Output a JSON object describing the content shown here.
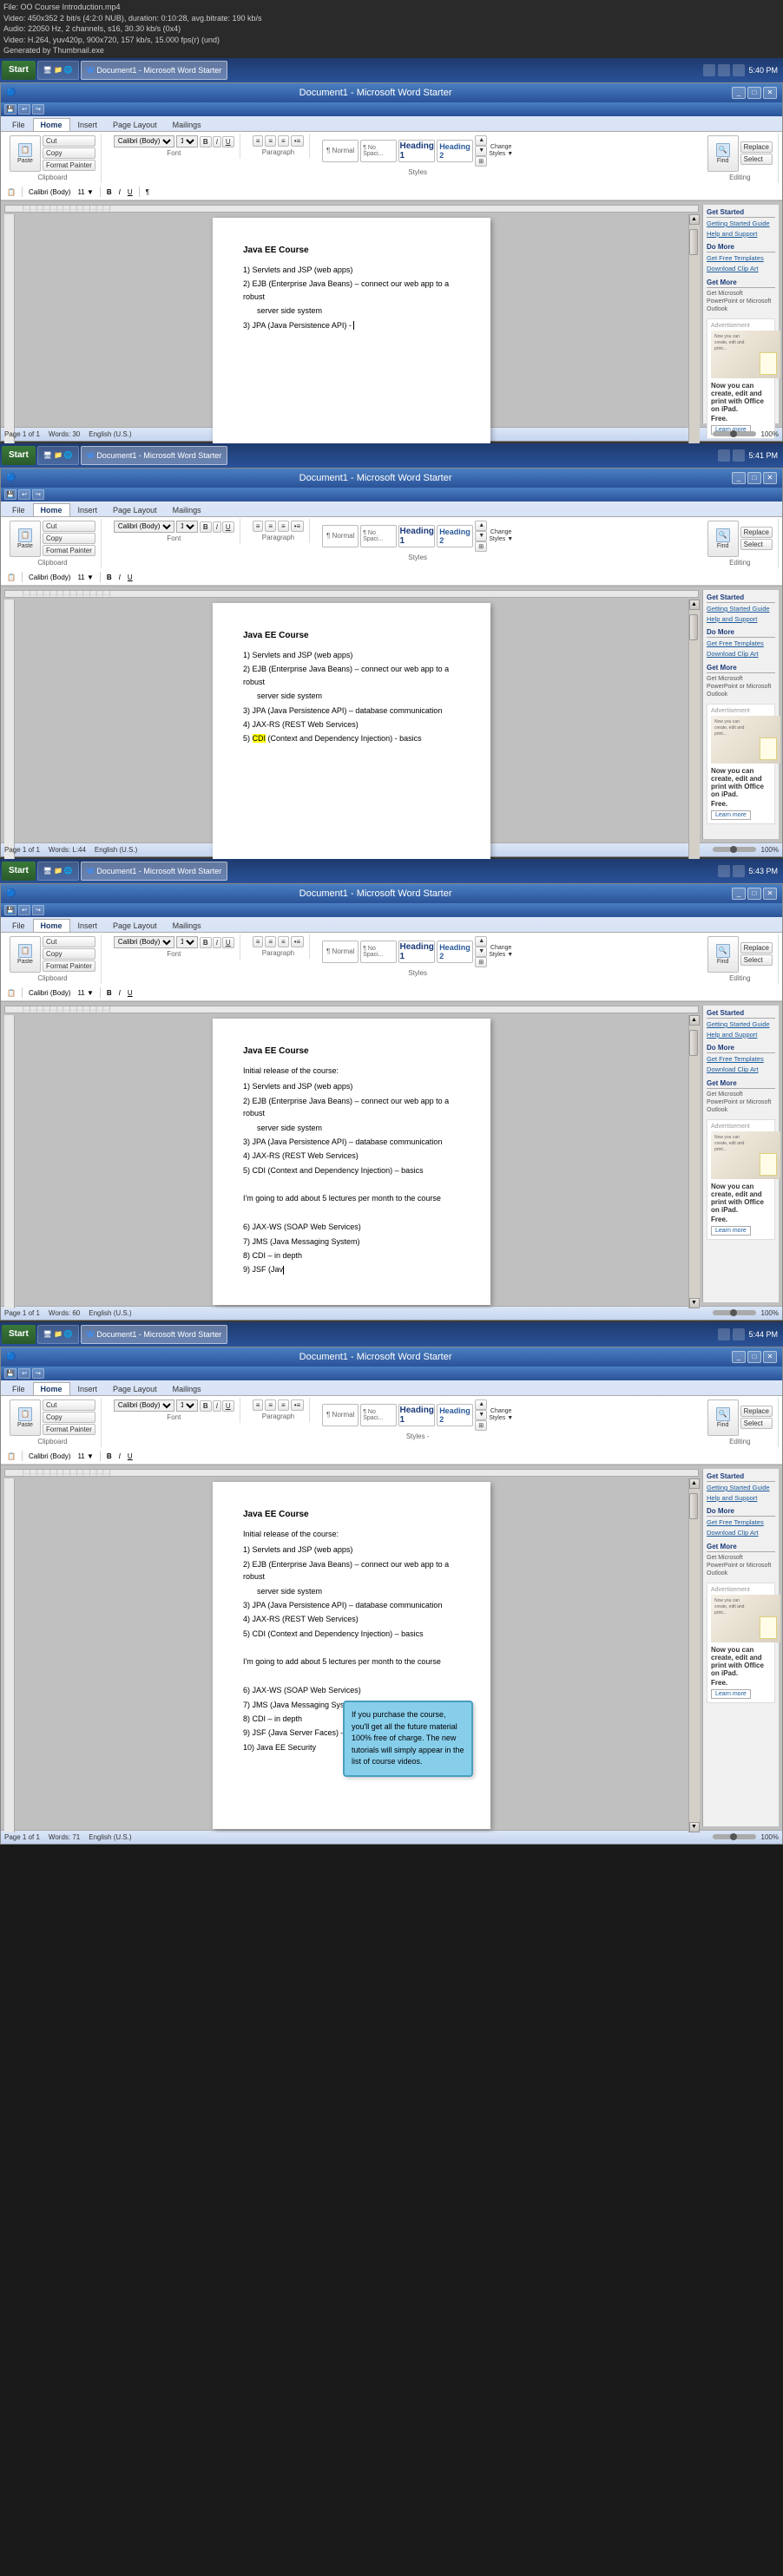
{
  "video_info": {
    "file": "File: OO Course Introduction.mp4",
    "specs1": "Video: 450x352 2 bit/s (4:2:0 NUB), duration: 0:10:28, avg.bitrate: 190 kb/s",
    "specs2": "Audio: 22050 Hz, 2 channels, s16, 30.30 kb/s (0x4)",
    "specs3": "Video: H.264, yuv420p, 900x720, 157 kb/s, 15.000 fps(r) (und)",
    "generated": "Generated by Thumbnail.exe"
  },
  "frames": [
    {
      "id": 1,
      "time": "5:40 PM",
      "title": "Document1 - Microsoft Word Starter",
      "tabs": [
        "File",
        "Home",
        "Insert",
        "Page Layout",
        "Mailings"
      ],
      "active_tab": "Home",
      "doc_title": "Java EE Course",
      "doc_content": [
        "1)  Servlets and JSP (web apps)",
        "2)  EJB (Enterprise Java Beans) – connect our web app to a robust",
        "      server side system",
        "3)  JPA (Java Persistence API) -"
      ],
      "cursor_at_end": true,
      "page_info": "Page 1 of 1",
      "words": "Words: 30",
      "lang": "English (U.S.)",
      "zoom": "100%"
    },
    {
      "id": 2,
      "time": "5:41 PM",
      "title": "Document1 - Microsoft Word Starter",
      "tabs": [
        "File",
        "Home",
        "Insert",
        "Page Layout",
        "Mailings"
      ],
      "active_tab": "Home",
      "doc_title": "Java EE Course",
      "doc_content": [
        "1)  Servlets and JSP (web apps)",
        "2)  EJB (Enterprise Java Beans) – connect our web app to a robust",
        "      server side system",
        "3)  JPA (Java Persistence API) – database communication",
        "4)  JAX-RS (REST Web Services)",
        "5)  CDI (Context and Dependency Injection) - basics"
      ],
      "highlighted_item": "5",
      "page_info": "Page 1 of 1",
      "words": "Words: L:44",
      "lang": "English (U.S.)",
      "zoom": "100%"
    },
    {
      "id": 3,
      "time": "5:43 PM",
      "title": "Document1 - Microsoft Word Starter",
      "tabs": [
        "File",
        "Home",
        "Insert",
        "Page Layout",
        "Mailings"
      ],
      "active_tab": "Home",
      "doc_title": "Java EE Course",
      "doc_subtitle": "Initial release of the course:",
      "doc_content": [
        "1)  Servlets and JSP (web apps)",
        "2)  EJB (Enterprise Java Beans) – connect our web app to a robust",
        "      server side system",
        "3)  JPA (Java Persistence API) – database communication",
        "4)  JAX-RS (REST Web Services)",
        "5)  CDI (Context and Dependency Injection) – basics",
        "",
        "I'm going to add about 5 lectures per month to the course",
        "",
        "6)  JAX-WS (SOAP Web Services)",
        "7)  JMS (Java Messaging System)",
        "8)  CDI – in depth",
        "9)  JSF (Jav"
      ],
      "cursor_at_end": true,
      "page_info": "Page 1 of 1",
      "words": "Words: 60",
      "lang": "English (U.S.)",
      "zoom": "100%"
    },
    {
      "id": 4,
      "time": "5:44 PM",
      "title": "Document1 - Microsoft Word Starter",
      "tabs": [
        "File",
        "Home",
        "Insert",
        "Page Layout",
        "Mailings"
      ],
      "active_tab": "Home",
      "doc_title": "Java EE Course",
      "doc_subtitle": "Initial release of the course:",
      "doc_content": [
        "1)  Servlets and JSP (web apps)",
        "2)  EJB (Enterprise Java Beans) – connect our web app to a robust",
        "      server side system",
        "3)  JPA (Java Persistence API) – database communication",
        "4)  JAX-RS (REST Web Services)",
        "5)  CDI (Context and Dependency Injection) – basics",
        "",
        "I'm going to add about 5 lectures per month to the course",
        "",
        "6)  JAX-WS (SOAP Web Services)",
        "7)  JMS (Java Messaging System)",
        "8)  CDI – in depth",
        "9)  JSF (Java Server Faces) – front end web framework",
        "10) Java EE Security"
      ],
      "callout": {
        "text": "If you purchase the course, you'll get all the future material 100% free of charge. The new tutorials will simply appear in the list of course videos."
      },
      "page_info": "Page 1 of 1",
      "words": "Words: 71",
      "lang": "English (U.S.)",
      "zoom": "100%"
    }
  ],
  "sidebar": {
    "get_started_title": "Get Started",
    "getting_started_guide": "Getting Started Guide",
    "help_and_support": "Help and Support",
    "do_more_title": "Do More",
    "get_free_templates": "Get Free Templates",
    "download_clip_art": "Download Clip Art",
    "get_more_title": "Get More",
    "get_more_desc": "Get Microsoft PowerPoint or Microsoft Outlook",
    "ad_title": "Now you can create, edit and print with Office on iPad.",
    "ad_free": "Free.",
    "learn_more": "Learn more"
  },
  "ribbon": {
    "clipboard_label": "Clipboard",
    "font_label": "Font",
    "paragraph_label": "Paragraph",
    "styles_label": "Styles",
    "editing_label": "Editing",
    "paste_label": "Paste",
    "cut_label": "Cut",
    "copy_label": "Copy",
    "format_painter_label": "Format Painter",
    "font_name": "Calibri (Body)",
    "font_size": "11",
    "normal_label": "¶ Normal",
    "no_spacing_label": "¶ No Spaci...",
    "heading1_label": "Heading 1",
    "heading2_label": "Heading 2",
    "change_styles_label": "Change Styles",
    "styles_dash": "Styles -",
    "find_label": "Find",
    "replace_label": "Replace",
    "select_label": "Select"
  }
}
